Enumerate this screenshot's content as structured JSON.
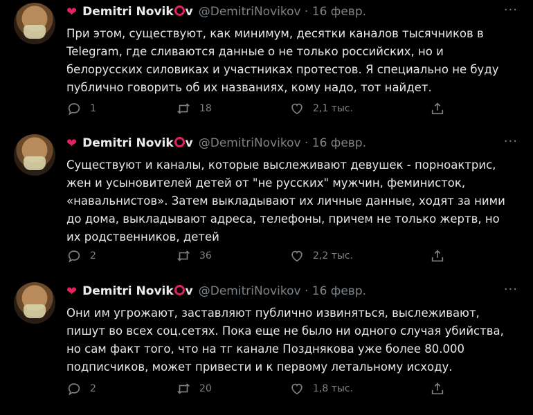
{
  "tweets": [
    {
      "name": "Demitri Novik",
      "name_suffix": "v",
      "handle": "@DemitriNovikov · 16 февр.",
      "text": "При этом, существуют, как минимум, десятки каналов тысячников в Telegram, где сливаются данные о не только российских, но и белорусских силовиках и участниках протестов. Я специально не буду публично говорить об их названиях, кому надо, тот найдет.",
      "replies": "1",
      "retweets": "18",
      "likes": "2,1 тыс."
    },
    {
      "name": "Demitri Novik",
      "name_suffix": "v",
      "handle": "@DemitriNovikov · 16 февр.",
      "text": "Существуют и каналы, которые выслеживают девушек - порноактрис, жен и усыновителей детей от \"не русских\" мужчин, феминисток, «навальнистов». Затем выкладывают их личные данные, ходят за ними до дома, выкладывают адреса, телефоны, причем не только жертв, но их родственников, детей",
      "replies": "2",
      "retweets": "36",
      "likes": "2,2 тыс."
    },
    {
      "name": "Demitri Novik",
      "name_suffix": "v",
      "handle": "@DemitriNovikov · 16 февр.",
      "text": "Они им угрожают, заставляют публично извиняться, выслеживают, пишут во всех соц.сетях. Пока еще не было ни одного случая убийства, но сам факт того, что на тг канале Позднякова уже более 80.000 подписчиков, может привести и к первому летальному исходу.",
      "replies": "2",
      "retweets": "20",
      "likes": "1,8 тыс."
    }
  ],
  "icons": {
    "heart": "heart-icon",
    "ring": "ring-icon",
    "reply": "reply-icon",
    "retweet": "retweet-icon",
    "like": "like-icon",
    "share": "share-icon",
    "more": "more-icon"
  },
  "colors": {
    "background": "#000000",
    "accent": "#e0245e",
    "muted": "#7c8389"
  }
}
